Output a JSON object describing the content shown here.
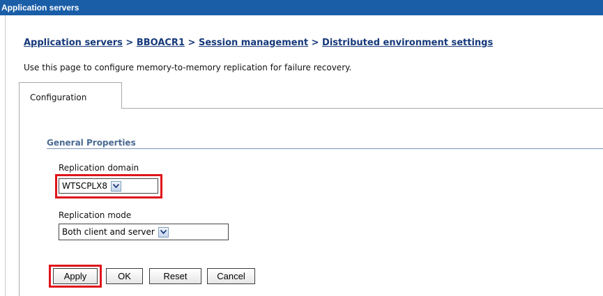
{
  "header": {
    "title": "Application servers"
  },
  "breadcrumb": {
    "items": [
      "Application servers",
      "BBOACR1",
      "Session management",
      "Distributed environment settings"
    ],
    "separator": ">"
  },
  "description": "Use this page to configure memory-to-memory replication for failure recovery.",
  "tabs": [
    {
      "label": "Configuration",
      "active": true
    }
  ],
  "general_properties": {
    "title": "General Properties",
    "replication_domain": {
      "label": "Replication domain",
      "value": "WTSCPLX8"
    },
    "replication_mode": {
      "label": "Replication mode",
      "value": "Both client and server"
    }
  },
  "buttons": {
    "apply": "Apply",
    "ok": "OK",
    "reset": "Reset",
    "cancel": "Cancel"
  },
  "colors": {
    "title_bar": "#1a5ea8",
    "link": "#16397a",
    "highlight": "#e0141b",
    "section_title": "#4a6a93"
  }
}
